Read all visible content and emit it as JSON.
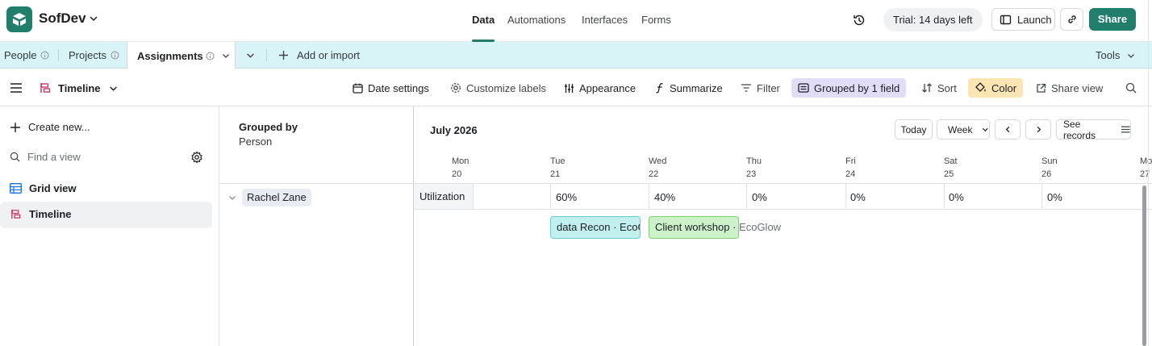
{
  "app": {
    "base_name": "SofDev",
    "nav_tabs": [
      "Data",
      "Automations",
      "Interfaces",
      "Forms"
    ],
    "active_nav": "Data",
    "trial": "Trial: 14 days left",
    "launch": "Launch",
    "share": "Share",
    "brand_color": "#207e6b"
  },
  "tables": {
    "items": [
      "People",
      "Projects",
      "Assignments"
    ],
    "active": "Assignments",
    "add_or_import": "Add or import",
    "tools": "Tools"
  },
  "viewbar": {
    "view_name": "Timeline",
    "date_settings": "Date settings",
    "customize_labels": "Customize labels",
    "appearance": "Appearance",
    "summarize": "Summarize",
    "filter": "Filter",
    "grouped": "Grouped by 1 field",
    "sort": "Sort",
    "color": "Color",
    "share_view": "Share view"
  },
  "sidebar": {
    "create_new": "Create new...",
    "find_placeholder": "Find a view",
    "views": [
      "Grid view",
      "Timeline"
    ],
    "active_view": "Timeline"
  },
  "grouping": {
    "title": "Grouped by",
    "field": "Person",
    "groups": [
      "Rachel Zane"
    ]
  },
  "timeline": {
    "month": "July 2026",
    "today": "Today",
    "range": "Week",
    "see_records": "See records",
    "days": [
      {
        "name": "Mon",
        "num": "20"
      },
      {
        "name": "Tue",
        "num": "21"
      },
      {
        "name": "Wed",
        "num": "22"
      },
      {
        "name": "Thu",
        "num": "23"
      },
      {
        "name": "Fri",
        "num": "24"
      },
      {
        "name": "Sat",
        "num": "25"
      },
      {
        "name": "Sun",
        "num": "26"
      },
      {
        "name": "Mo",
        "num": "27"
      }
    ],
    "utilization_label": "Utilization",
    "utilization": [
      "60%",
      "40%",
      "0%",
      "0%",
      "0%",
      "0%"
    ],
    "records": [
      {
        "label": "data Recon · EcoG",
        "color": "#c2f0ef"
      },
      {
        "label": "Client workshop · ",
        "overflow": "EcoGlow",
        "color": "#cdf2c9"
      }
    ]
  }
}
